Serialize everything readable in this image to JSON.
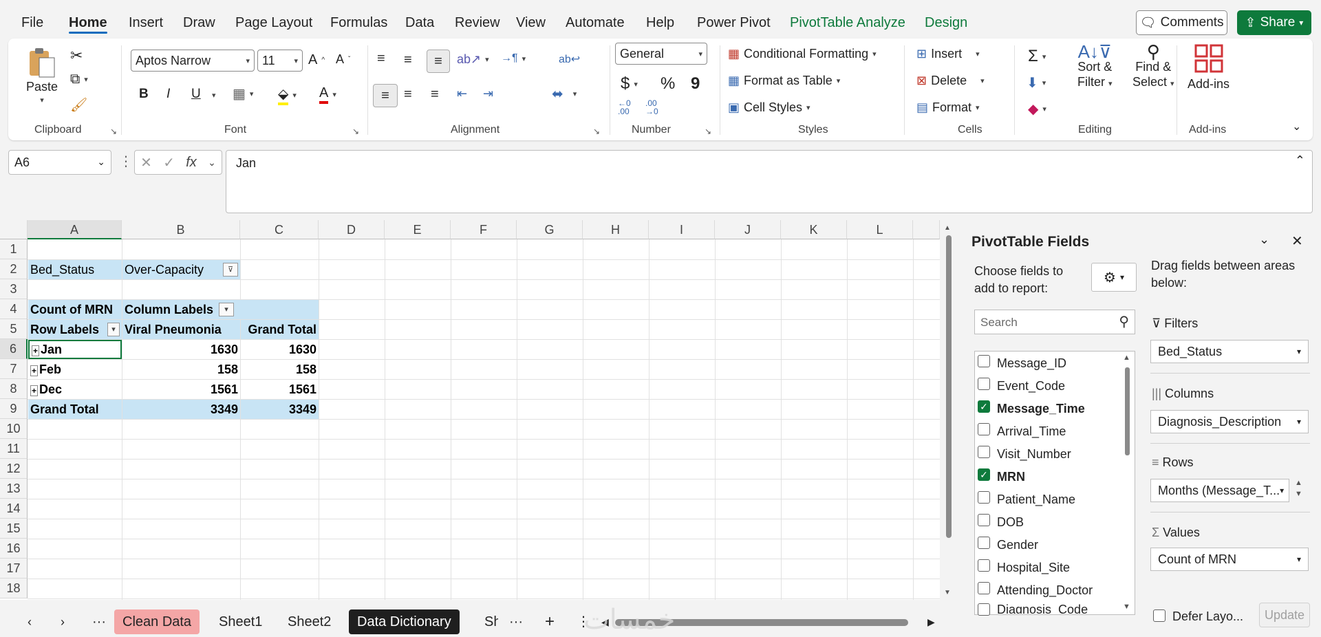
{
  "menu": {
    "items": [
      "File",
      "Home",
      "Insert",
      "Draw",
      "Page Layout",
      "Formulas",
      "Data",
      "Review",
      "View",
      "Automate",
      "Help",
      "Power Pivot",
      "PivotTable Analyze",
      "Design"
    ],
    "comments_label": "Comments",
    "share_label": "Share"
  },
  "ribbon": {
    "clipboard": {
      "paste_label": "Paste",
      "group_label": "Clipboard"
    },
    "font": {
      "font_name": "Aptos Narrow",
      "font_size": "11",
      "group_label": "Font",
      "bold": "B",
      "italic": "I",
      "underline": "U",
      "font_color_glyph": "A"
    },
    "alignment": {
      "group_label": "Alignment"
    },
    "number": {
      "format": "General",
      "group_label": "Number",
      "currency": "$",
      "percent": "%",
      "comma": "9"
    },
    "styles": {
      "conditional_formatting": "Conditional Formatting",
      "format_as_table": "Format as Table",
      "cell_styles": "Cell Styles",
      "group_label": "Styles"
    },
    "cells": {
      "insert": "Insert",
      "delete": "Delete",
      "format": "Format",
      "group_label": "Cells"
    },
    "editing": {
      "sort_filter_line1": "Sort &",
      "sort_filter_line2": "Filter",
      "find_select_line1": "Find &",
      "find_select_line2": "Select",
      "group_label": "Editing"
    },
    "addins": {
      "label": "Add-ins",
      "group_label": "Add-ins"
    }
  },
  "formula_bar": {
    "name_box": "A6",
    "fx": "fx",
    "value": "Jan"
  },
  "columns": [
    "A",
    "B",
    "C",
    "D",
    "E",
    "F",
    "G",
    "H",
    "I",
    "J",
    "K",
    "L"
  ],
  "rows": [
    "1",
    "2",
    "3",
    "4",
    "5",
    "6",
    "7",
    "8",
    "9",
    "10",
    "11",
    "12",
    "13",
    "14",
    "15",
    "16",
    "17",
    "18"
  ],
  "pivot": {
    "filter_field": "Bed_Status",
    "filter_value": "Over-Capacity",
    "values_label": "Count of MRN",
    "column_labels": "Column Labels",
    "row_labels": "Row Labels",
    "col_b_header": "Viral Pneumonia",
    "col_c_header": "Grand Total",
    "rows": [
      {
        "label": "Jan",
        "b": "1630",
        "c": "1630"
      },
      {
        "label": "Feb",
        "b": "158",
        "c": "158"
      },
      {
        "label": "Dec",
        "b": "1561",
        "c": "1561"
      }
    ],
    "grand_total_label": "Grand Total",
    "grand_total_b": "3349",
    "grand_total_c": "3349"
  },
  "sheet_tabs": [
    "Clean Data",
    "Sheet1",
    "Sheet2",
    "Data Dictionary",
    "Sh"
  ],
  "watermark": "خمسات",
  "pane": {
    "title": "PivotTable Fields",
    "choose_line1": "Choose fields to",
    "choose_line2": "add to report:",
    "drag_line1": "Drag fields between areas",
    "drag_line2": "below:",
    "search_placeholder": "Search",
    "fields": [
      {
        "name": "Message_ID",
        "checked": false
      },
      {
        "name": "Event_Code",
        "checked": false
      },
      {
        "name": "Message_Time",
        "checked": true
      },
      {
        "name": "Arrival_Time",
        "checked": false
      },
      {
        "name": "Visit_Number",
        "checked": false
      },
      {
        "name": "MRN",
        "checked": true
      },
      {
        "name": "Patient_Name",
        "checked": false
      },
      {
        "name": "DOB",
        "checked": false
      },
      {
        "name": "Gender",
        "checked": false
      },
      {
        "name": "Hospital_Site",
        "checked": false
      },
      {
        "name": "Attending_Doctor",
        "checked": false
      },
      {
        "name": "Diagnosis_Code",
        "checked": false
      }
    ],
    "filters_title": "Filters",
    "filters_value": "Bed_Status",
    "columns_title": "Columns",
    "columns_value": "Diagnosis_Description",
    "rows_title": "Rows",
    "rows_value": "Months (Message_T...",
    "values_title": "Values",
    "values_value": "Count of MRN",
    "defer_label": "Defer Layo...",
    "update_label": "Update"
  },
  "colors": {
    "accent_green": "#0e7a3c",
    "pivot_blue": "#c8e4f5",
    "active_tab": "#f4a6a6",
    "dark_tab": "#1f1f1f"
  }
}
